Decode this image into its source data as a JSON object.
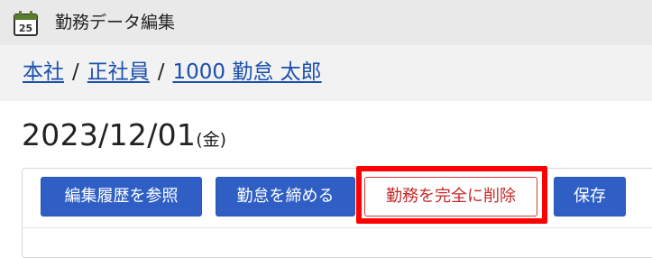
{
  "app": {
    "title": "勤務データ編集",
    "icon_label": "25"
  },
  "breadcrumb": {
    "items": [
      "本社",
      "正社員",
      "1000 勤怠 太郎"
    ],
    "separator": "/"
  },
  "record": {
    "date": "2023/12/01",
    "weekday": "(金)"
  },
  "toolbar": {
    "history_label": "編集履歴を参照",
    "close_label": "勤怠を締める",
    "delete_label": "勤務を完全に削除",
    "save_label": "保存"
  },
  "colors": {
    "primary": "#2f5fc5",
    "danger": "#c62828",
    "highlight": "#ff0000",
    "link": "#1a4fae"
  }
}
